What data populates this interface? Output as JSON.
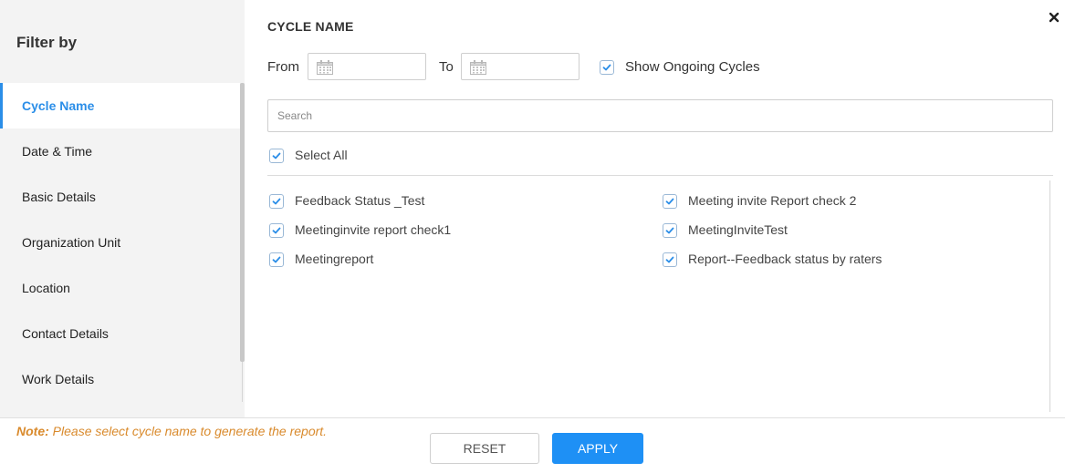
{
  "sidebar": {
    "title": "Filter by",
    "items": [
      {
        "label": "Cycle Name",
        "active": true
      },
      {
        "label": "Date & Time"
      },
      {
        "label": "Basic Details"
      },
      {
        "label": "Organization Unit"
      },
      {
        "label": "Location"
      },
      {
        "label": "Contact Details"
      },
      {
        "label": "Work Details"
      }
    ]
  },
  "main": {
    "section_title": "CYCLE NAME",
    "from_label": "From",
    "to_label": "To",
    "from_value": "",
    "to_value": "",
    "show_ongoing_label": "Show Ongoing Cycles",
    "show_ongoing_checked": true,
    "search_placeholder": "Search",
    "select_all_label": "Select All",
    "select_all_checked": true,
    "cycles": [
      {
        "label": "Feedback Status _Test",
        "checked": true
      },
      {
        "label": "Meeting invite Report check 2",
        "checked": true
      },
      {
        "label": "Meetinginvite report check1",
        "checked": true
      },
      {
        "label": "MeetingInviteTest",
        "checked": true
      },
      {
        "label": "Meetingreport",
        "checked": true
      },
      {
        "label": "Report--Feedback status by raters",
        "checked": true
      }
    ]
  },
  "footer": {
    "note_prefix": "Note:",
    "note_text": " Please select cycle name to generate the report.",
    "reset_label": "RESET",
    "apply_label": "APPLY"
  },
  "colors": {
    "accent": "#2b8ee8",
    "apply_button": "#1e90f5",
    "note": "#d98a2c",
    "sidebar_bg": "#f3f3f3"
  },
  "icons": {
    "close": "close-icon",
    "calendar": "calendar-icon",
    "checkbox": "checkmark-icon"
  }
}
